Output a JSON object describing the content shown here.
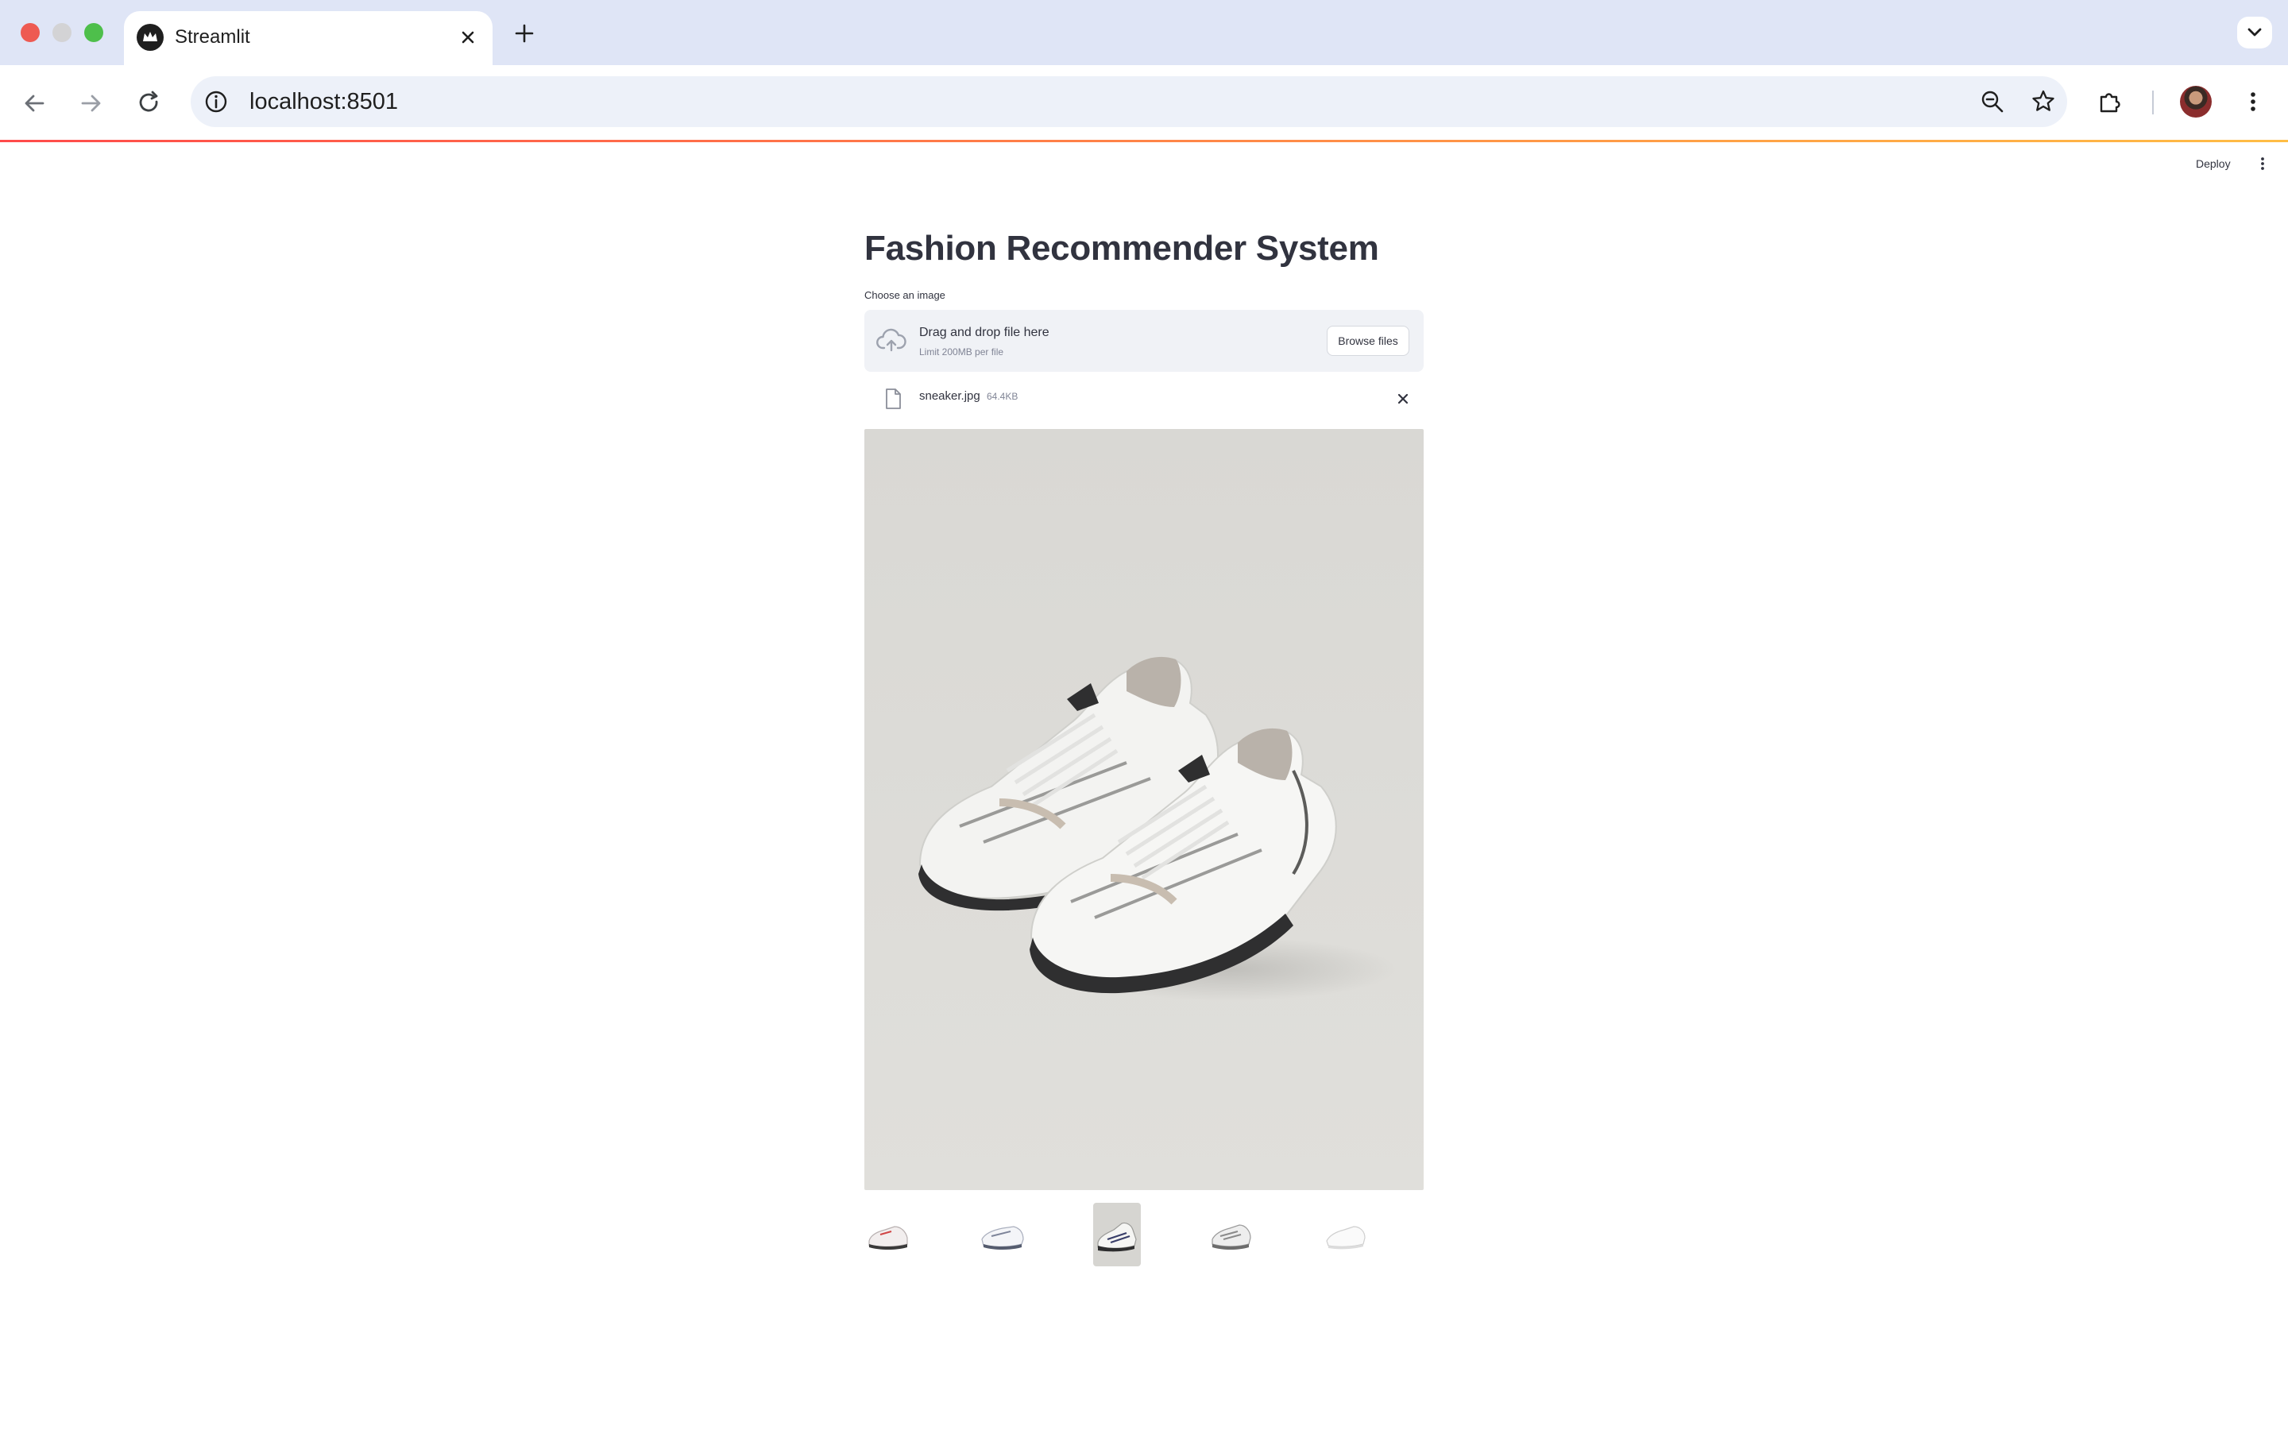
{
  "browser": {
    "tab_title": "Streamlit",
    "url": "localhost:8501"
  },
  "app": {
    "deploy_label": "Deploy",
    "title": "Fashion Recommender System",
    "uploader": {
      "label": "Choose an image",
      "drop_text": "Drag and drop file here",
      "limit_text": "Limit 200MB per file",
      "browse_label": "Browse files"
    },
    "uploaded_file": {
      "name": "sneaker.jpg",
      "size": "64.4KB"
    },
    "recommendations": [
      {
        "icon": "sneaker-thumbnail-1"
      },
      {
        "icon": "sneaker-thumbnail-2"
      },
      {
        "icon": "sneaker-thumbnail-3"
      },
      {
        "icon": "sneaker-thumbnail-4"
      },
      {
        "icon": "sneaker-thumbnail-5"
      }
    ]
  },
  "colors": {
    "accent_start": "#ff4b4b",
    "accent_end": "#ffbd45",
    "text": "#31333f",
    "muted_text": "#808495",
    "dropzone_bg": "#f0f2f6"
  }
}
